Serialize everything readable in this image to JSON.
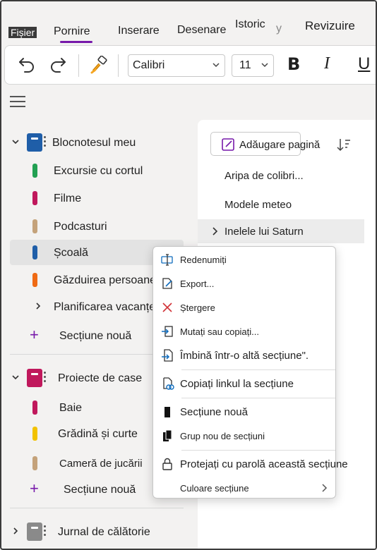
{
  "ribbon": {
    "tabs": {
      "file": "Fișier",
      "home": "Pornire",
      "insert": "Inserare",
      "draw": "Desenare",
      "history": "Istoric",
      "view": "y",
      "review": "Revizuire"
    },
    "font_name": "Calibri",
    "font_size": "11",
    "bold": "B",
    "italic": "I",
    "underline": "U"
  },
  "notebooks": [
    {
      "name": "Blocnotesul meu",
      "color": "#1f5ea8",
      "sections": [
        {
          "label": "Excursie cu cortul",
          "color": "#22a052"
        },
        {
          "label": "Filme",
          "color": "#c0185c"
        },
        {
          "label": "Podcasturi",
          "color": "#c4a27a"
        },
        {
          "label": "Școală",
          "color": "#1f5ea8"
        },
        {
          "label": "Găzduirea persoanelor",
          "color": "#ef6a14"
        },
        {
          "label": "Planificarea vacanțelor"
        }
      ],
      "new_section": "Secțiune nouă"
    },
    {
      "name": "Proiecte de case",
      "color": "#c0185c",
      "sections": [
        {
          "label": "Baie",
          "color": "#c0185c"
        },
        {
          "label": "Grădină și curte",
          "color": "#f2c200"
        },
        {
          "label": "Cameră de jucării",
          "color": "#c4a27a"
        }
      ],
      "new_section": "Secțiune nouă"
    },
    {
      "name": "Jurnal de călătorie",
      "color": "#8a8a8a"
    }
  ],
  "pages_pane": {
    "add_page": "Adăugare pagină",
    "pages": [
      "Aripa de colibri...",
      "Modele meteo",
      "Inelele lui Saturn"
    ]
  },
  "context_menu": {
    "items": [
      "Redenumiți",
      "Export...",
      "Ștergere",
      "Mutați sau copiați...",
      "Îmbină într-o altă secțiune\".",
      "Copiați linkul la secțiune",
      "Secțiune nouă",
      "Grup nou de secțiuni",
      "Protejați cu parolă această secțiune",
      "Culoare secțiune"
    ]
  },
  "colors": {
    "accent": "#7719aa",
    "delete_red": "#d13438",
    "link_blue": "#0f6cbd"
  }
}
